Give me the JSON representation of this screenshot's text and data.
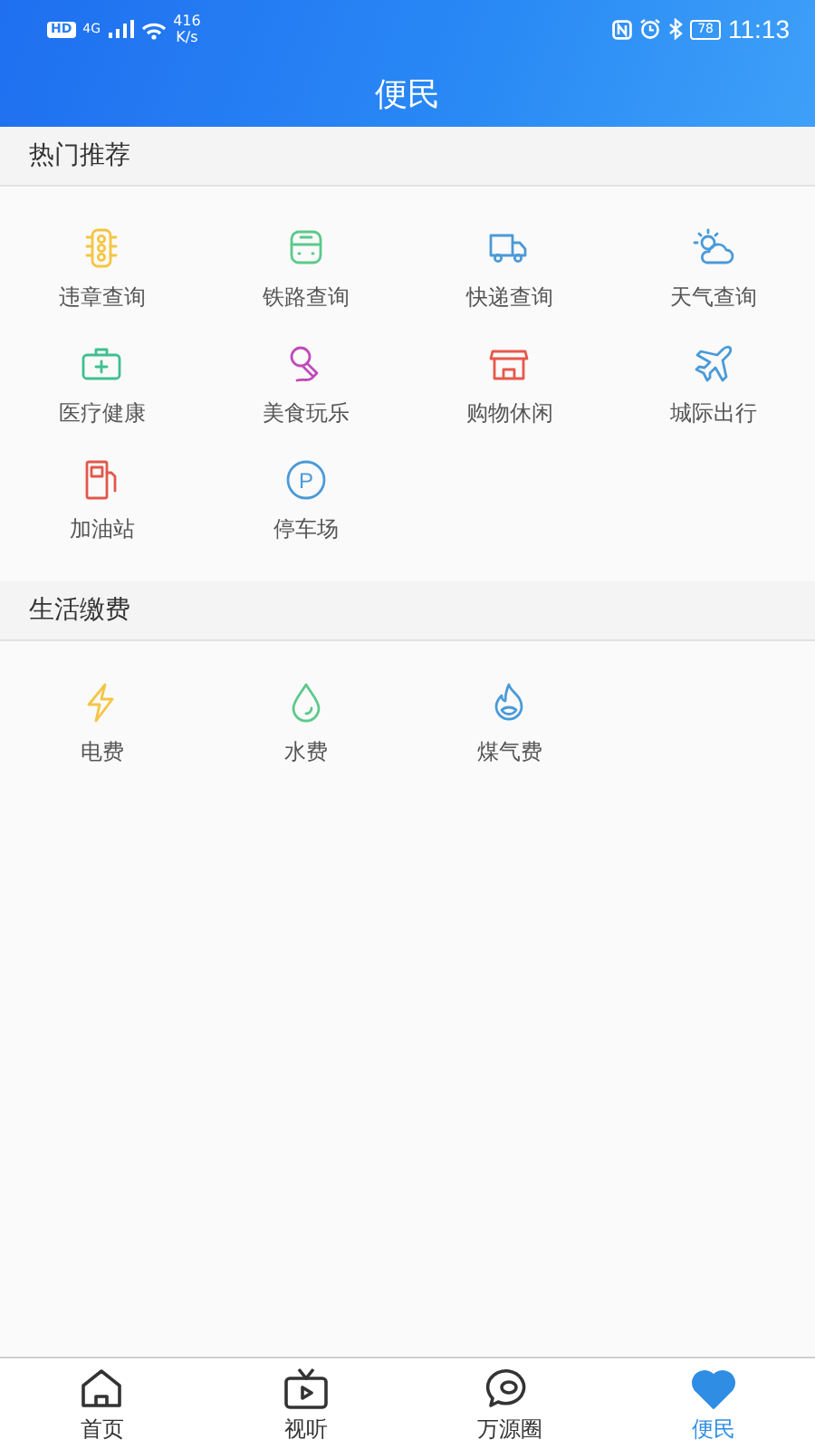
{
  "status_bar": {
    "hd": "HD",
    "network": "4G",
    "speed": "416",
    "speed_unit": "K/s",
    "battery": "78",
    "time": "11:13"
  },
  "header": {
    "title": "便民"
  },
  "sections": [
    {
      "title": "热门推荐",
      "items": [
        {
          "label": "违章查询",
          "kind": "traffic-light",
          "color": "#f5c542"
        },
        {
          "label": "铁路查询",
          "kind": "train",
          "color": "#5cc98a"
        },
        {
          "label": "快递查询",
          "kind": "truck",
          "color": "#4a9ad8"
        },
        {
          "label": "天气查询",
          "kind": "weather",
          "color": "#4a9ad8"
        },
        {
          "label": "医疗健康",
          "kind": "medkit",
          "color": "#3fbf8f"
        },
        {
          "label": "美食玩乐",
          "kind": "microphone",
          "color": "#c04ab8"
        },
        {
          "label": "购物休闲",
          "kind": "shop",
          "color": "#e8584a"
        },
        {
          "label": "城际出行",
          "kind": "plane",
          "color": "#4a9ad8"
        },
        {
          "label": "加油站",
          "kind": "fuel",
          "color": "#e0584a"
        },
        {
          "label": "停车场",
          "kind": "parking",
          "color": "#4a9ad8",
          "glyph": "P"
        }
      ]
    },
    {
      "title": "生活缴费",
      "items": [
        {
          "label": "电费",
          "kind": "bolt",
          "color": "#f5c542"
        },
        {
          "label": "水费",
          "kind": "drop",
          "color": "#5cc98a"
        },
        {
          "label": "煤气费",
          "kind": "flame",
          "color": "#4a9ad8"
        }
      ]
    }
  ],
  "tabs": [
    {
      "label": "首页",
      "kind": "home",
      "selected": false
    },
    {
      "label": "视听",
      "kind": "tv",
      "selected": false
    },
    {
      "label": "万源圈",
      "kind": "chat",
      "selected": false
    },
    {
      "label": "便民",
      "kind": "heart",
      "selected": true
    }
  ]
}
